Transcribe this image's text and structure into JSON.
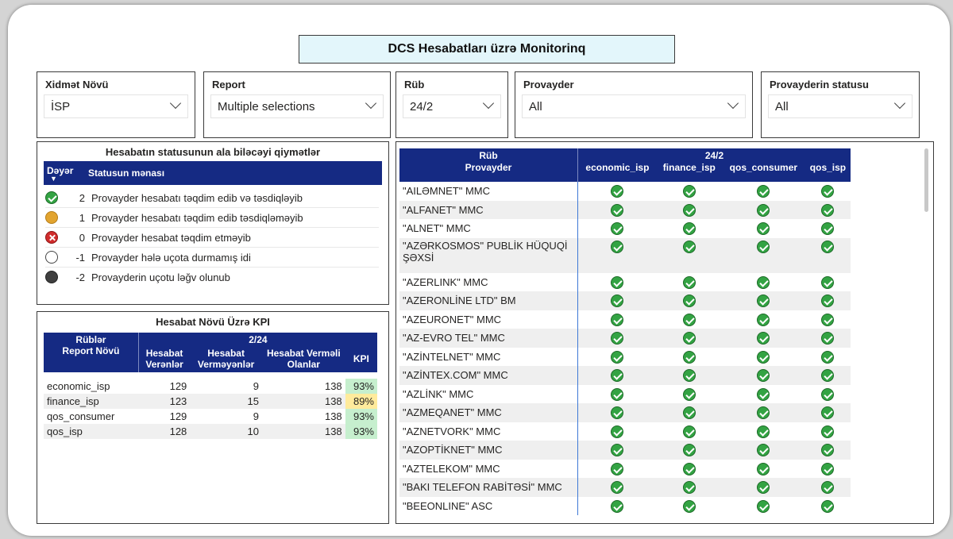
{
  "title": "DCS Hesabatları üzrə Monitorinq",
  "filters": [
    {
      "label": "Xidmət Növü",
      "value": "İSP"
    },
    {
      "label": "Report",
      "value": "Multiple selections"
    },
    {
      "label": "Rüb",
      "value": "24/2"
    },
    {
      "label": "Provayder",
      "value": "All"
    },
    {
      "label": "Provayderin statusu",
      "value": "All"
    }
  ],
  "status_legend": {
    "title": "Hesabatın statusunun ala biləcəyi qiymətlər",
    "col_value": "Dəyər",
    "col_meaning": "Statusun mənası",
    "rows": [
      {
        "icon": "green-check-icon",
        "value": "2",
        "text": "Provayder hesabatı təqdim edib və təsdiqləyib"
      },
      {
        "icon": "orange-circle-icon",
        "value": "1",
        "text": "Provayder hesabatı təqdim edib təsdiqləməyib"
      },
      {
        "icon": "red-x-icon",
        "value": "0",
        "text": "Provayder hesabat təqdim etməyib"
      },
      {
        "icon": "empty-circle-icon",
        "value": "-1",
        "text": "Provayder hələ uçota durmamış idi"
      },
      {
        "icon": "dark-circle-icon",
        "value": "-2",
        "text": "Provayderin uçotu ləğv olunub"
      }
    ]
  },
  "kpi": {
    "title": "Hesabat Növü Üzrə KPI",
    "h_rubler": "Rüblər",
    "h_period": "2/24",
    "h_report": "Report Növü",
    "h_cols": [
      "Hesabat Verənlər",
      "Hesabat Verməyənlər",
      "Hesabat Verməli Olanlar",
      "KPI"
    ],
    "rows": [
      {
        "name": "economic_isp",
        "given": "129",
        "not_given": "9",
        "total": "138",
        "kpi": "93%",
        "color": "#c6efce"
      },
      {
        "name": "finance_isp",
        "given": "123",
        "not_given": "15",
        "total": "138",
        "kpi": "89%",
        "color": "#ffeb9c"
      },
      {
        "name": "qos_consumer",
        "given": "129",
        "not_given": "9",
        "total": "138",
        "kpi": "93%",
        "color": "#c6efce"
      },
      {
        "name": "qos_isp",
        "given": "128",
        "not_given": "10",
        "total": "138",
        "kpi": "93%",
        "color": "#c6efce"
      }
    ]
  },
  "providers": {
    "h_rub": "Rüb",
    "h_provider": "Provayder",
    "h_period": "24/2",
    "columns": [
      "economic_isp",
      "finance_isp",
      "qos_consumer",
      "qos_isp"
    ],
    "status_icon": "green-check-icon",
    "rows": [
      "\"AILƏMNET\" MMC",
      "\"ALFANET\" MMC",
      "\"ALNET\" MMC",
      "\"AZƏRKOSMOS\" PUBLİK HÜQUQİ ŞƏXSİ",
      "\"AZERLINK\" MMC",
      "\"AZERONLİNE LTD\" BM",
      "\"AZEURONET\" MMC",
      "\"AZ-EVRO TEL\" MMC",
      "\"AZİNTELNET\" MMC",
      "\"AZİNTEX.COM\" MMC",
      "\"AZLİNK\" MMC",
      "\"AZMEQANET\" MMC",
      "\"AZNETVORK\" MMC",
      "\"AZOPTİKNET\" MMC",
      "\"AZTELEKOM\" MMC",
      "\"BAKI TELEFON RABİTƏSİ\" MMC",
      "\"BEEONLINE\" ASC"
    ]
  }
}
